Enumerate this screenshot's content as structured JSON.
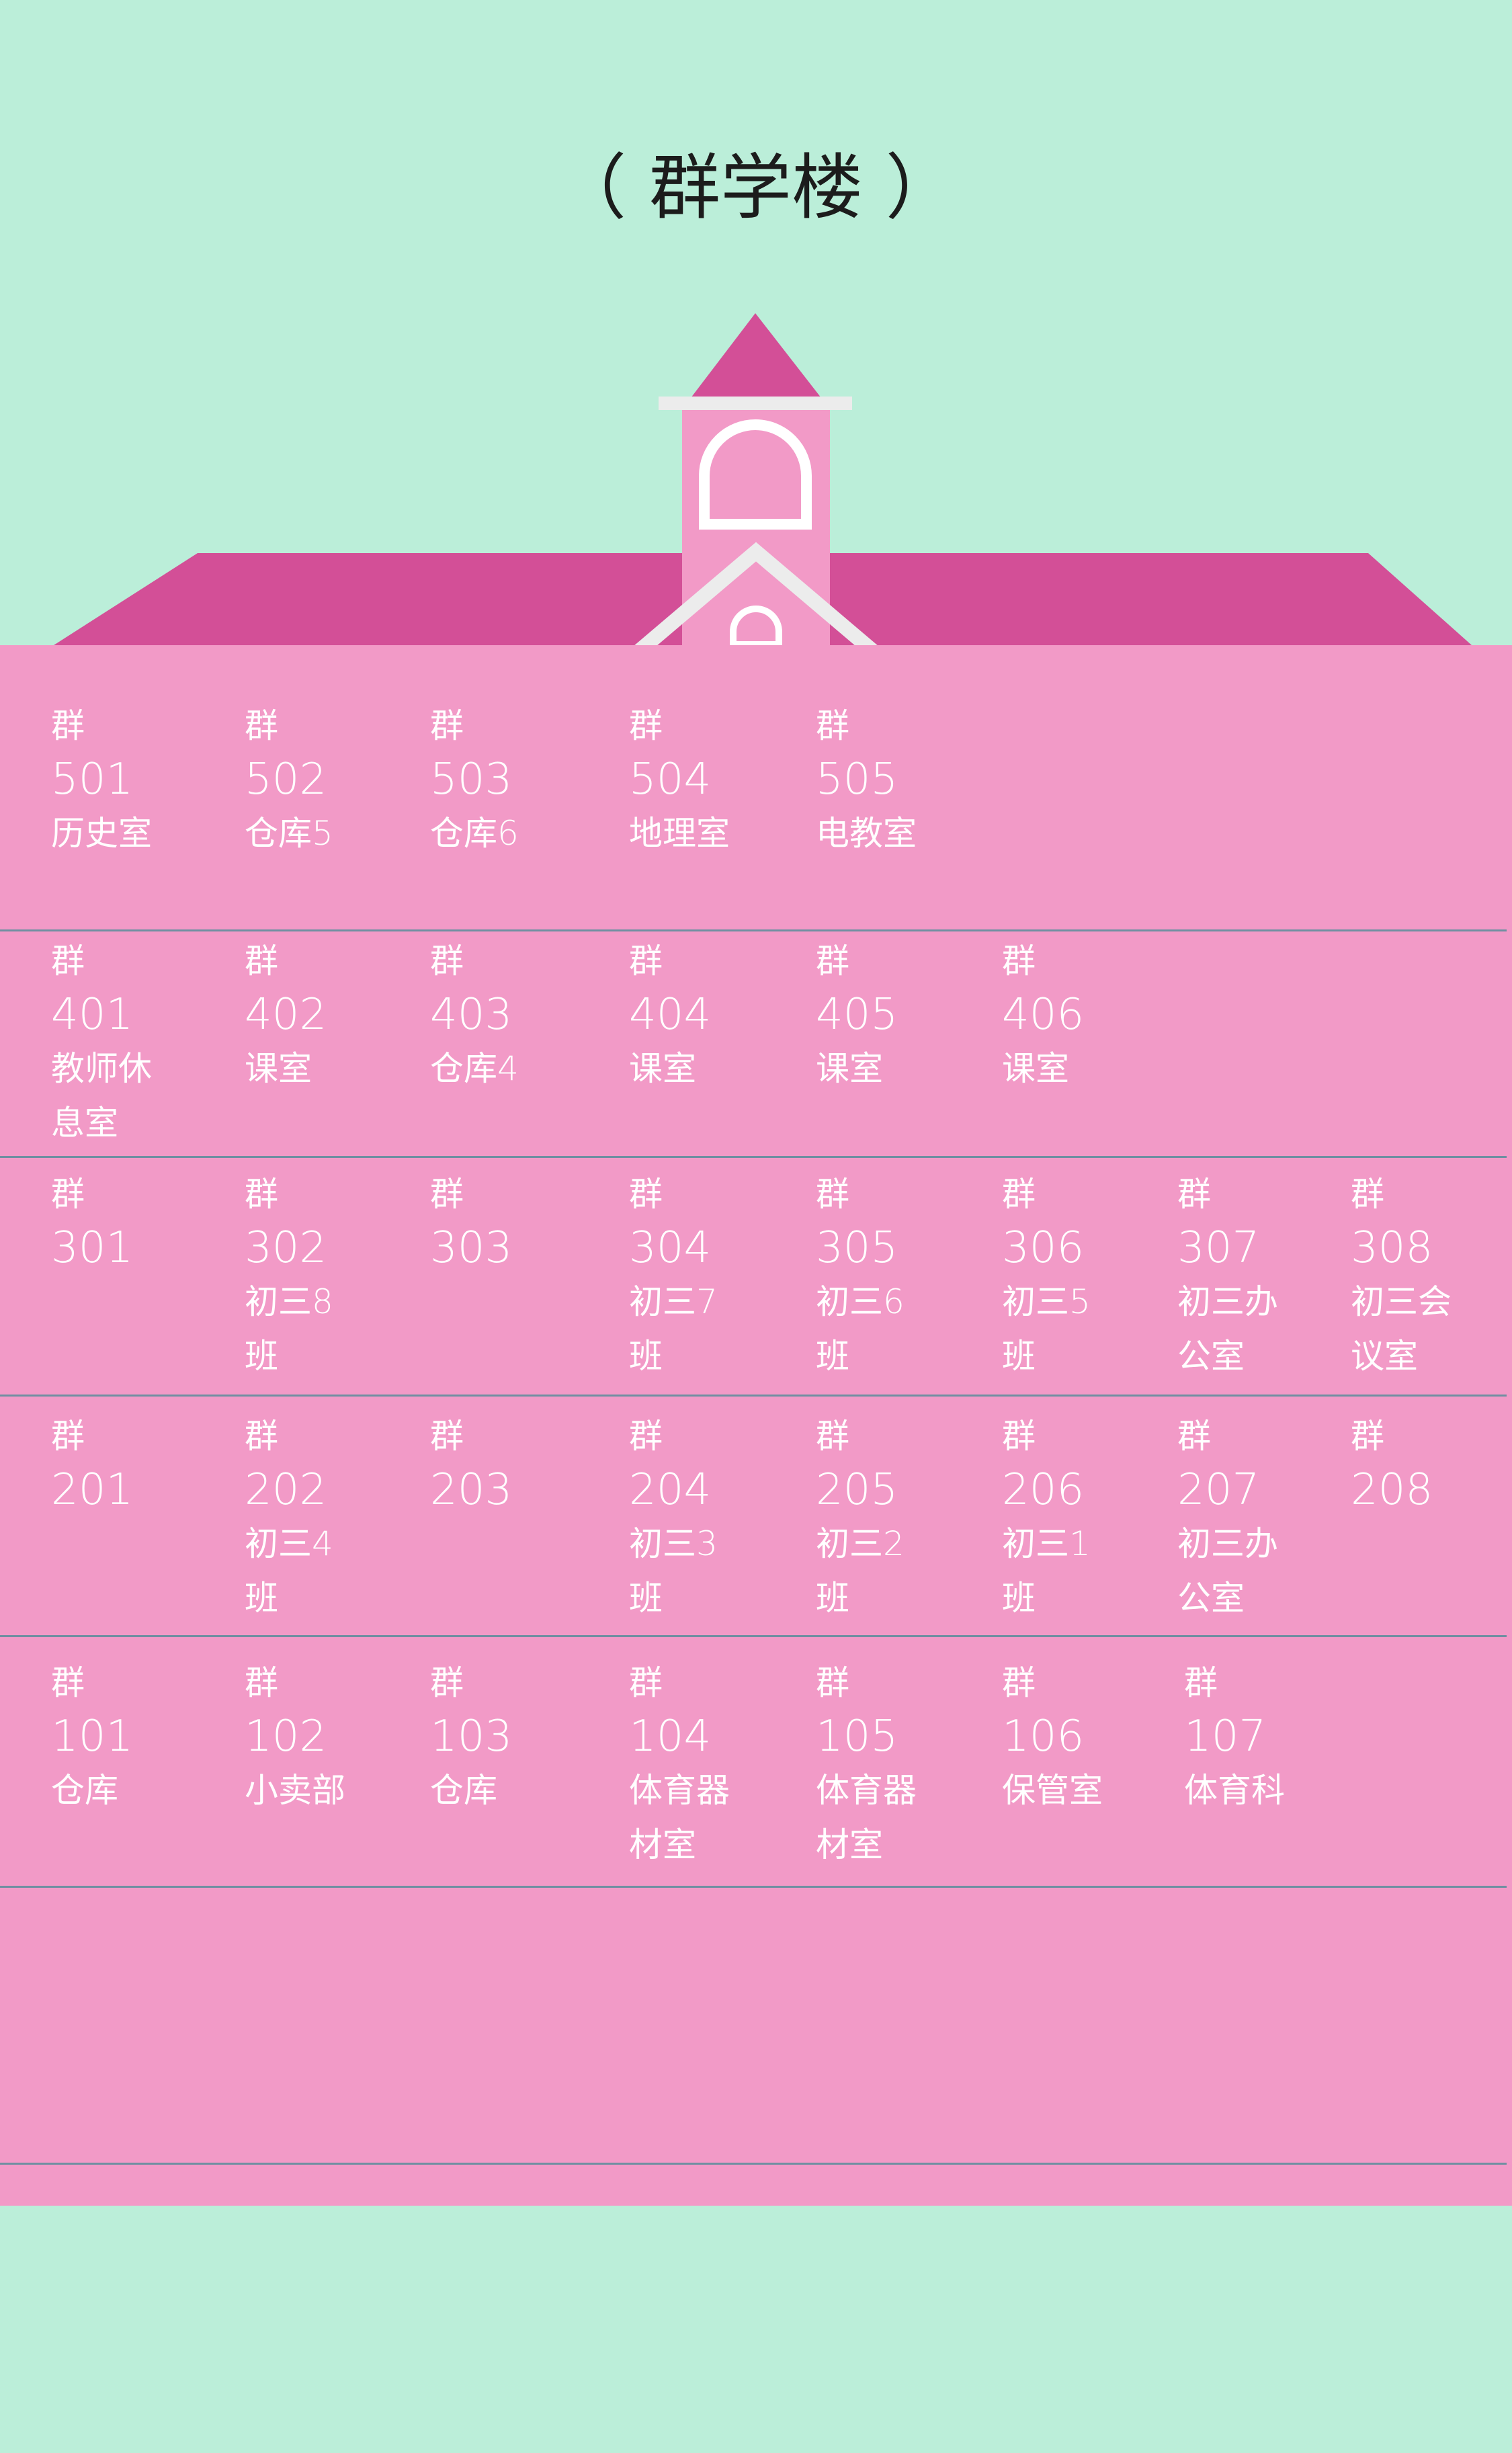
{
  "title": "（ 群学楼 ）",
  "colors": {
    "background": "#bbeed9",
    "building": "#f29ac7",
    "roof": "#d34f97",
    "window_frame": "#ffffff",
    "eave": "#ececec",
    "floor_divider": "#6f8fa1",
    "text": "#ffffff",
    "title_text": "#1c1c1c"
  },
  "floors": [
    {
      "level": 5,
      "rooms": [
        {
          "prefix": "群",
          "number": "501",
          "purpose": "历史室"
        },
        {
          "prefix": "群",
          "number": "502",
          "purpose": "仓库5"
        },
        {
          "prefix": "群",
          "number": "503",
          "purpose": "仓库6"
        },
        {
          "prefix": "群",
          "number": "504",
          "purpose": "地理室"
        },
        {
          "prefix": "群",
          "number": "505",
          "purpose": "电教室"
        }
      ]
    },
    {
      "level": 4,
      "rooms": [
        {
          "prefix": "群",
          "number": "401",
          "purpose": "教师休\n息室"
        },
        {
          "prefix": "群",
          "number": "402",
          "purpose": "课室"
        },
        {
          "prefix": "群",
          "number": "403",
          "purpose": "仓库4"
        },
        {
          "prefix": "群",
          "number": "404",
          "purpose": "课室"
        },
        {
          "prefix": "群",
          "number": "405",
          "purpose": "课室"
        },
        {
          "prefix": "群",
          "number": "406",
          "purpose": "课室"
        }
      ]
    },
    {
      "level": 3,
      "rooms": [
        {
          "prefix": "群",
          "number": "301",
          "purpose": ""
        },
        {
          "prefix": "群",
          "number": "302",
          "purpose": "初三8\n班"
        },
        {
          "prefix": "群",
          "number": "303",
          "purpose": ""
        },
        {
          "prefix": "群",
          "number": "304",
          "purpose": "初三7\n班"
        },
        {
          "prefix": "群",
          "number": "305",
          "purpose": "初三6\n班"
        },
        {
          "prefix": "群",
          "number": "306",
          "purpose": "初三5\n班"
        },
        {
          "prefix": "群",
          "number": "307",
          "purpose": "初三办\n公室"
        },
        {
          "prefix": "群",
          "number": "308",
          "purpose": "初三会\n议室"
        }
      ]
    },
    {
      "level": 2,
      "rooms": [
        {
          "prefix": "群",
          "number": "201",
          "purpose": ""
        },
        {
          "prefix": "群",
          "number": "202",
          "purpose": "初三4\n班"
        },
        {
          "prefix": "群",
          "number": "203",
          "purpose": ""
        },
        {
          "prefix": "群",
          "number": "204",
          "purpose": "初三3\n班"
        },
        {
          "prefix": "群",
          "number": "205",
          "purpose": "初三2\n班"
        },
        {
          "prefix": "群",
          "number": "206",
          "purpose": "初三1\n班"
        },
        {
          "prefix": "群",
          "number": "207",
          "purpose": "初三办\n公室"
        },
        {
          "prefix": "群",
          "number": "208",
          "purpose": ""
        }
      ]
    },
    {
      "level": 1,
      "rooms": [
        {
          "prefix": "群",
          "number": "101",
          "purpose": "仓库"
        },
        {
          "prefix": "群",
          "number": "102",
          "purpose": "小卖部"
        },
        {
          "prefix": "群",
          "number": "103",
          "purpose": "仓库"
        },
        {
          "prefix": "群",
          "number": "104",
          "purpose": "体育器\n材室"
        },
        {
          "prefix": "群",
          "number": "105",
          "purpose": "体育器\n材室"
        },
        {
          "prefix": "群",
          "number": "106",
          "purpose": "保管室"
        },
        {
          "prefix": "群",
          "number": "107",
          "purpose": "体育科"
        }
      ]
    }
  ]
}
